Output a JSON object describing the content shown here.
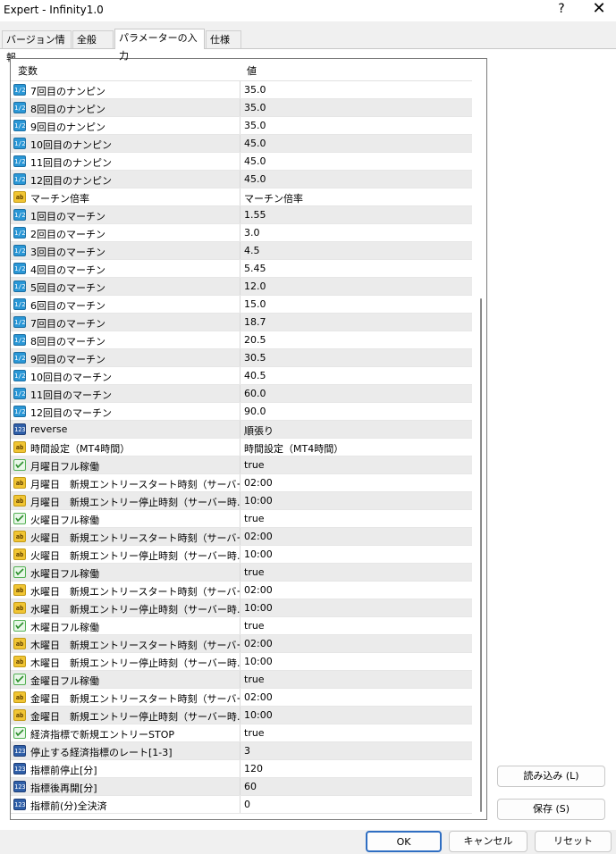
{
  "window": {
    "title": "Expert - Infinity1.0",
    "help": "?",
    "close": "✕"
  },
  "tabs": [
    "バージョン情報",
    "全般",
    "パラメーターの入力",
    "仕様"
  ],
  "grid": {
    "col_name": "変数",
    "col_value": "値",
    "rows": [
      {
        "type": "dbl",
        "icon": "1/2",
        "name": "7回目のナンピン",
        "value": "35.0"
      },
      {
        "type": "dbl",
        "icon": "1/2",
        "name": "8回目のナンピン",
        "value": "35.0"
      },
      {
        "type": "dbl",
        "icon": "1/2",
        "name": "9回目のナンピン",
        "value": "35.0"
      },
      {
        "type": "dbl",
        "icon": "1/2",
        "name": "10回目のナンピン",
        "value": "45.0"
      },
      {
        "type": "dbl",
        "icon": "1/2",
        "name": "11回目のナンピン",
        "value": "45.0"
      },
      {
        "type": "dbl",
        "icon": "1/2",
        "name": "12回目のナンピン",
        "value": "45.0"
      },
      {
        "type": "str",
        "icon": "ab",
        "name": "マーチン倍率",
        "value": "マーチン倍率"
      },
      {
        "type": "dbl",
        "icon": "1/2",
        "name": "1回目のマーチン",
        "value": "1.55"
      },
      {
        "type": "dbl",
        "icon": "1/2",
        "name": "2回目のマーチン",
        "value": "3.0"
      },
      {
        "type": "dbl",
        "icon": "1/2",
        "name": "3回目のマーチン",
        "value": "4.5"
      },
      {
        "type": "dbl",
        "icon": "1/2",
        "name": "4回目のマーチン",
        "value": "5.45"
      },
      {
        "type": "dbl",
        "icon": "1/2",
        "name": "5回目のマーチン",
        "value": "12.0"
      },
      {
        "type": "dbl",
        "icon": "1/2",
        "name": "6回目のマーチン",
        "value": "15.0"
      },
      {
        "type": "dbl",
        "icon": "1/2",
        "name": "7回目のマーチン",
        "value": "18.7"
      },
      {
        "type": "dbl",
        "icon": "1/2",
        "name": "8回目のマーチン",
        "value": "20.5"
      },
      {
        "type": "dbl",
        "icon": "1/2",
        "name": "9回目のマーチン",
        "value": "30.5"
      },
      {
        "type": "dbl",
        "icon": "1/2",
        "name": "10回目のマーチン",
        "value": "40.5"
      },
      {
        "type": "dbl",
        "icon": "1/2",
        "name": "11回目のマーチン",
        "value": "60.0"
      },
      {
        "type": "dbl",
        "icon": "1/2",
        "name": "12回目のマーチン",
        "value": "90.0"
      },
      {
        "type": "int",
        "icon": "123",
        "name": "reverse",
        "value": "順張り"
      },
      {
        "type": "str",
        "icon": "ab",
        "name": "時間設定（MT4時間）",
        "value": "時間設定（MT4時間）"
      },
      {
        "type": "bool",
        "icon": "",
        "name": "月曜日フル稼働",
        "value": "true"
      },
      {
        "type": "str",
        "icon": "ab",
        "name": "月曜日　新規エントリースタート時刻（サーバー…",
        "value": "02:00"
      },
      {
        "type": "str",
        "icon": "ab",
        "name": "月曜日　新規エントリー停止時刻（サーバー時…",
        "value": "10:00"
      },
      {
        "type": "bool",
        "icon": "",
        "name": "火曜日フル稼働",
        "value": "true"
      },
      {
        "type": "str",
        "icon": "ab",
        "name": "火曜日　新規エントリースタート時刻（サーバー…",
        "value": "02:00"
      },
      {
        "type": "str",
        "icon": "ab",
        "name": "火曜日　新規エントリー停止時刻（サーバー時…",
        "value": "10:00"
      },
      {
        "type": "bool",
        "icon": "",
        "name": "水曜日フル稼働",
        "value": "true"
      },
      {
        "type": "str",
        "icon": "ab",
        "name": "水曜日　新規エントリースタート時刻（サーバー…",
        "value": "02:00"
      },
      {
        "type": "str",
        "icon": "ab",
        "name": "水曜日　新規エントリー停止時刻（サーバー時…",
        "value": "10:00"
      },
      {
        "type": "bool",
        "icon": "",
        "name": "木曜日フル稼働",
        "value": "true"
      },
      {
        "type": "str",
        "icon": "ab",
        "name": "木曜日　新規エントリースタート時刻（サーバー…",
        "value": "02:00"
      },
      {
        "type": "str",
        "icon": "ab",
        "name": "木曜日　新規エントリー停止時刻（サーバー時…",
        "value": "10:00"
      },
      {
        "type": "bool",
        "icon": "",
        "name": "金曜日フル稼働",
        "value": "true"
      },
      {
        "type": "str",
        "icon": "ab",
        "name": "金曜日　新規エントリースタート時刻（サーバー…",
        "value": "02:00"
      },
      {
        "type": "str",
        "icon": "ab",
        "name": "金曜日　新規エントリー停止時刻（サーバー時…",
        "value": "10:00"
      },
      {
        "type": "bool",
        "icon": "",
        "name": "経済指標で新規エントリーSTOP",
        "value": "true"
      },
      {
        "type": "int",
        "icon": "123",
        "name": "停止する経済指標のレート[1-3]",
        "value": "3"
      },
      {
        "type": "int",
        "icon": "123",
        "name": "指標前停止[分]",
        "value": "120"
      },
      {
        "type": "int",
        "icon": "123",
        "name": "指標後再開[分]",
        "value": "60"
      },
      {
        "type": "int",
        "icon": "123",
        "name": "指標前(分)全決済",
        "value": "0"
      }
    ]
  },
  "buttons": {
    "load": "読み込み (L)",
    "save": "保存 (S)",
    "ok": "OK",
    "cancel": "キャンセル",
    "reset": "リセット"
  },
  "colors": {
    "row_alt": "#ebebeb",
    "ok_border": "#2f6ec2"
  }
}
